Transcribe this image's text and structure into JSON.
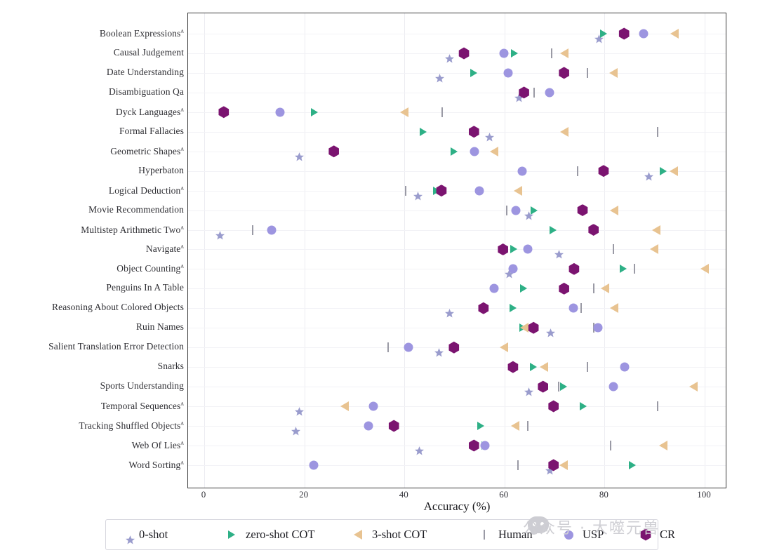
{
  "chart_data": {
    "type": "scatter",
    "title": "",
    "xlabel": "Accuracy (%)",
    "ylabel": "",
    "xlim": [
      -2,
      103
    ],
    "xticks": [
      0,
      20,
      40,
      60,
      80,
      100
    ],
    "grid": true,
    "legend_position": "below",
    "categories": [
      "Boolean Expressions^",
      "Causal Judgement",
      "Date Understanding",
      "Disambiguation Qa",
      "Dyck Languages^",
      "Formal Fallacies",
      "Geometric Shapes^",
      "Hyperbaton",
      "Logical Deduction^",
      "Movie Recommendation",
      "Multistep Arithmetic Two^",
      "Navigate^",
      "Object Counting^",
      "Penguins In A Table",
      "Reasoning About Colored Objects",
      "Ruin Names",
      "Salient Translation Error Detection",
      "Snarks",
      "Sports Understanding",
      "Temporal Sequences^",
      "Tracking Shuffled Objects^",
      "Web Of Lies^",
      "Word Sorting^"
    ],
    "series": [
      {
        "name": "0-shot",
        "marker": "star",
        "color": "#9a9ccd",
        "values": [
          77.8,
          48.0,
          46.0,
          61.9,
          null,
          56.0,
          18.0,
          87.8,
          41.7,
          63.8,
          2.1,
          69.8,
          59.9,
          null,
          48.0,
          68.2,
          45.9,
          null,
          63.8,
          18.0,
          17.3,
          41.9,
          68.0
        ]
      },
      {
        "name": "zero-shot COT",
        "marker": "triangle-right",
        "color": "#2eb086",
        "values": [
          79.8,
          62.0,
          53.9,
          null,
          22.0,
          43.8,
          49.9,
          91.7,
          46.4,
          65.9,
          69.7,
          61.9,
          83.7,
          63.8,
          61.7,
          63.7,
          null,
          65.8,
          71.8,
          75.7,
          55.3,
          56.1,
          85.6
        ]
      },
      {
        "name": "3-shot COT",
        "marker": "triangle-left",
        "color": "#e8c391",
        "values": [
          93.9,
          71.9,
          81.8,
          null,
          40.0,
          71.9,
          57.9,
          93.8,
          62.7,
          81.9,
          90.3,
          89.9,
          100.0,
          80.1,
          81.9,
          63.9,
          59.9,
          67.9,
          97.8,
          28.0,
          62.1,
          91.7,
          71.8
        ]
      },
      {
        "name": "Human",
        "marker": "vbar",
        "color": "#9a9aa5",
        "values": [
          null,
          69.4,
          76.6,
          65.9,
          47.5,
          90.6,
          null,
          74.6,
          40.3,
          60.4,
          9.7,
          81.8,
          86.0,
          77.8,
          75.3,
          77.8,
          36.7,
          76.6,
          70.8,
          90.6,
          64.7,
          81.2,
          62.7
        ]
      },
      {
        "name": "USP",
        "marker": "circle",
        "color": "#9d95e0",
        "values": [
          87.8,
          59.9,
          60.7,
          69.0,
          15.1,
          null,
          54.0,
          63.5,
          55.0,
          62.3,
          13.5,
          64.7,
          61.7,
          57.9,
          73.8,
          78.7,
          40.8,
          84.0,
          81.8,
          33.8,
          32.8,
          56.1,
          21.9
        ]
      },
      {
        "name": "CR",
        "marker": "hexagon",
        "color": "#7b1470",
        "values": [
          83.9,
          51.9,
          71.9,
          63.9,
          3.9,
          53.9,
          25.9,
          79.8,
          47.4,
          75.6,
          77.8,
          59.7,
          73.9,
          71.9,
          55.8,
          65.8,
          49.9,
          61.7,
          67.7,
          69.8,
          37.9,
          53.9,
          69.8
        ]
      }
    ]
  },
  "axis": {
    "x_title": "Accuracy (%)",
    "x_tick_labels": [
      "0",
      "20",
      "40",
      "60",
      "80",
      "100"
    ]
  },
  "legend": {
    "items": [
      {
        "label": "0-shot",
        "marker": "star-icon",
        "color": "#9a9ccd"
      },
      {
        "label": "zero-shot COT",
        "marker": "triangle-right-icon",
        "color": "#2eb086"
      },
      {
        "label": "3-shot COT",
        "marker": "triangle-left-icon",
        "color": "#e8c391"
      },
      {
        "label": "Human",
        "marker": "vertical-bar-icon",
        "color": "#9a9aa5"
      },
      {
        "label": "USP",
        "marker": "circle-icon",
        "color": "#9d95e0"
      },
      {
        "label": "CR",
        "marker": "hexagon-icon",
        "color": "#7b1470"
      }
    ]
  },
  "watermark": {
    "text": "公众号 · 大噬元兽"
  }
}
